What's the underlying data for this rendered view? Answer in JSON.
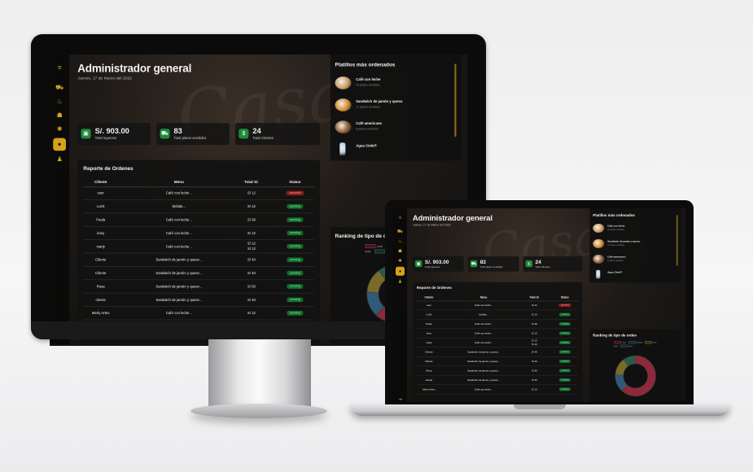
{
  "app": {
    "title": "Administrador general",
    "date": "Jueves, 17 de Marzo del 2022",
    "logout_icon": "logout-icon",
    "colors": {
      "accent": "#d5a21c",
      "pending": "#136b2e",
      "canceled": "#8a1c1c"
    }
  },
  "sidebar": {
    "items": [
      {
        "icon": "menu-icon",
        "glyph": "≡"
      },
      {
        "icon": "cart-icon",
        "glyph": "⛟"
      },
      {
        "icon": "food-icon",
        "glyph": "♨"
      },
      {
        "icon": "user-icon",
        "glyph": "☗"
      },
      {
        "icon": "settings-icon",
        "glyph": "✱"
      },
      {
        "icon": "dashboard-icon",
        "glyph": "●"
      },
      {
        "icon": "person-icon",
        "glyph": "♟"
      }
    ]
  },
  "stats": [
    {
      "value": "S/. 903.00",
      "label": "Total Ingresos",
      "icon": "bag-icon",
      "glyph": "▣"
    },
    {
      "value": "83",
      "label": "Total platos vendidos",
      "icon": "cart-icon",
      "glyph": "⛟"
    },
    {
      "value": "24",
      "label": "Total Clientes",
      "icon": "dollar-icon",
      "glyph": "$"
    }
  ],
  "report": {
    "title": "Reporte de Ordenes",
    "headers": [
      "Cliente",
      "Menu",
      "Total S/.",
      "Status"
    ],
    "rows": [
      {
        "cliente": "user",
        "menu": "Café con leche ..",
        "total": "S/ 12",
        "status": "canceled"
      },
      {
        "cliente": "LUIS",
        "menu": "bebida ..",
        "total": "S/ 12",
        "status": "pending"
      },
      {
        "cliente": "Paula",
        "menu": "Café con leche ..",
        "total": "S/ 36",
        "status": "pending"
      },
      {
        "cliente": "leiny",
        "menu": "Café con leche ..",
        "total": "S/ 12",
        "status": "pending"
      },
      {
        "cliente": "marly",
        "menu": "Café con leche ..",
        "total": "S/ 12\nS/ 12",
        "status": "pending"
      },
      {
        "cliente": "Cliente",
        "menu": "Sandwich de jamón y queso ..",
        "total": "S/ 40",
        "status": "pending"
      },
      {
        "cliente": "Cliente",
        "menu": "Sandwich de jamón y queso ..",
        "total": "S/ 40",
        "status": "pending"
      },
      {
        "cliente": "Rosa",
        "menu": "Sandwich de jamón y queso ..",
        "total": "S/ 50",
        "status": "pending"
      },
      {
        "cliente": "cliente",
        "menu": "Sandwich de jamón y queso ..",
        "total": "S/ 40",
        "status": "pending"
      },
      {
        "cliente": "Merly Arteo",
        "menu": "Café con leche ..",
        "total": "S/ 12",
        "status": "pending"
      }
    ]
  },
  "dishes": {
    "title": "Platillos más ordenados",
    "items": [
      {
        "name": "Café con leche",
        "sub": "24 platos vendidos",
        "color": "#c89a62"
      },
      {
        "name": "Sandwich de jamón y queso",
        "sub": "17 platos vendidos",
        "color": "#d08a2e"
      },
      {
        "name": "Café americano",
        "sub": "8 platos vendidos",
        "color": "#8a5a32"
      },
      {
        "name": "Agua Cielo®",
        "sub": "",
        "color": "#b8d4f0"
      }
    ]
  },
  "ranking": {
    "title": "Ranking de tipo de orden",
    "legend": [
      {
        "name": "Local",
        "color": "#8a2a3a"
      },
      {
        "name": "Delivery",
        "color": "#2f5a7a"
      },
      {
        "name": "Para llevar",
        "color": "#7a6a2a"
      },
      {
        "name": "Otros",
        "color": "#2a5a4a"
      }
    ],
    "shares": [
      0.62,
      0.14,
      0.14,
      0.1
    ]
  }
}
